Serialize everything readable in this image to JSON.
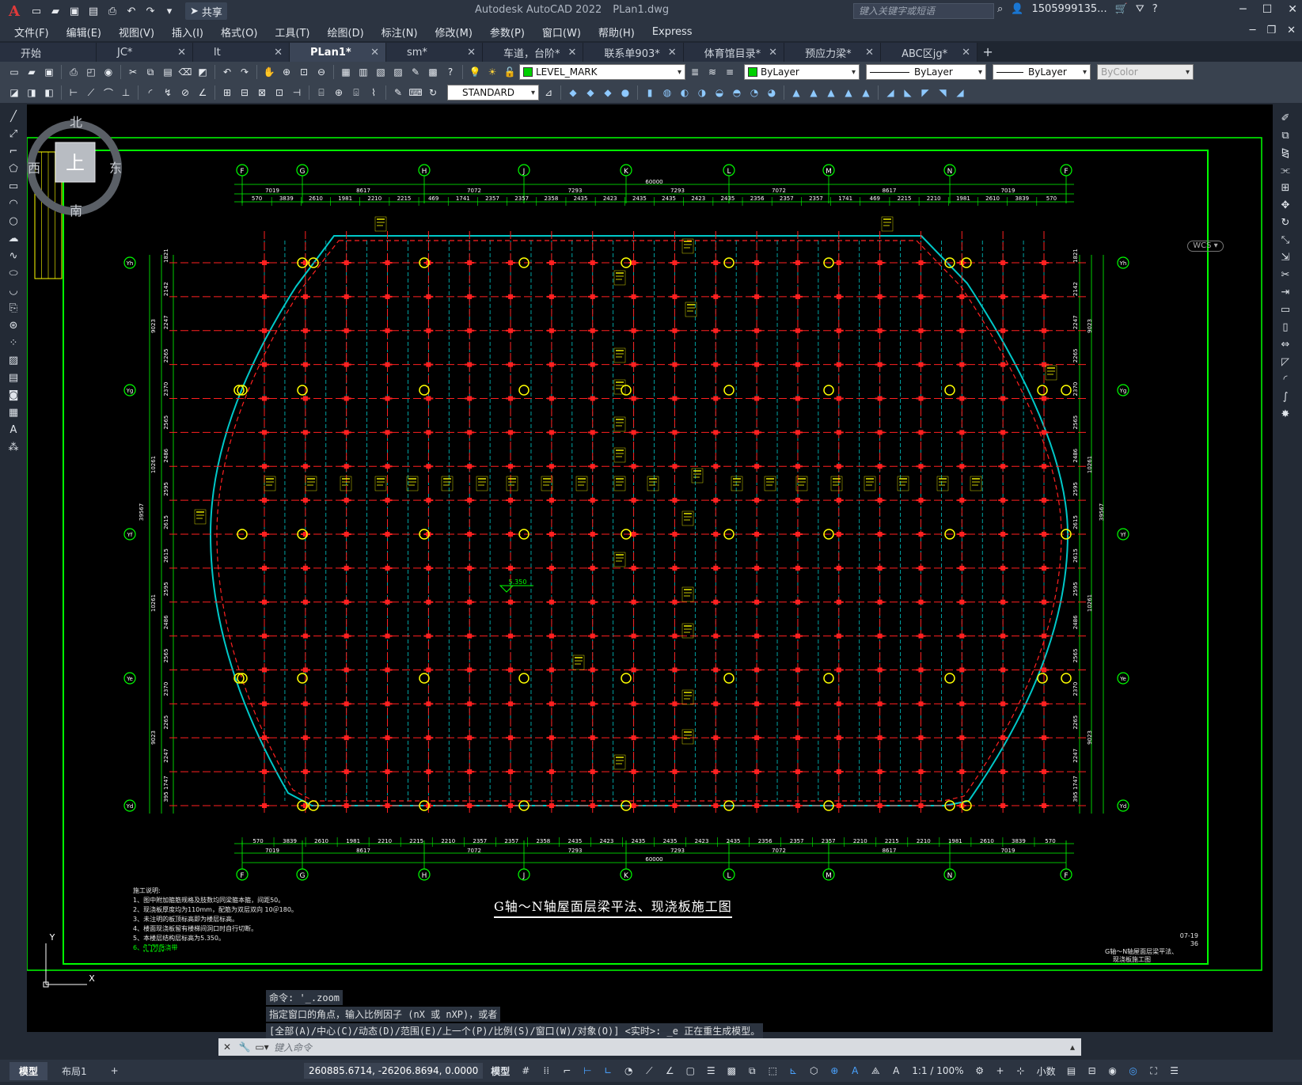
{
  "app": {
    "name": "Autodesk AutoCAD 2022",
    "file": "PLan1.dwg",
    "share_label": "共享",
    "search_placeholder": "键入关键字或短语",
    "user": "1505999135...",
    "logo": "A"
  },
  "menu": [
    "文件(F)",
    "编辑(E)",
    "视图(V)",
    "插入(I)",
    "格式(O)",
    "工具(T)",
    "绘图(D)",
    "标注(N)",
    "修改(M)",
    "参数(P)",
    "窗口(W)",
    "帮助(H)",
    "Express"
  ],
  "tabs": [
    {
      "label": "开始",
      "active": false
    },
    {
      "label": "JC*",
      "active": false
    },
    {
      "label": "lt",
      "active": false
    },
    {
      "label": "PLan1*",
      "active": true
    },
    {
      "label": "sm*",
      "active": false
    },
    {
      "label": "车道，台阶*",
      "active": false
    },
    {
      "label": "联系单903*",
      "active": false
    },
    {
      "label": "体育馆目录*",
      "active": false
    },
    {
      "label": "预应力梁*",
      "active": false
    },
    {
      "label": "ABC区jg*",
      "active": false
    }
  ],
  "properties": {
    "layer": "LEVEL_MARK",
    "color": "ByLayer",
    "linetype": "ByLayer",
    "lineweight": "ByLayer",
    "plotstyle": "ByColor",
    "textstyle": "STANDARD"
  },
  "viewcube": {
    "north": "北",
    "south": "南",
    "east": "东",
    "west": "西",
    "top": "上",
    "wcs": "WCS"
  },
  "drawing": {
    "title": "G轴～N轴屋面层梁平法、现浇板施工图",
    "level_mark": "5.350",
    "total_dim": "60000",
    "top_axes": [
      "F",
      "G",
      "H",
      "J",
      "K",
      "L",
      "M",
      "N",
      "F"
    ],
    "side_axes": [
      "Yh",
      "Yg",
      "Yf",
      "Ye",
      "Yd"
    ],
    "span_dims": [
      "7019",
      "8617",
      "7072",
      "7293",
      "7293",
      "7072",
      "8617",
      "7019"
    ],
    "detail_dims": [
      "570",
      "3839",
      "2610",
      "1981",
      "2210",
      "2215",
      "469",
      "1741",
      "2357",
      "2357",
      "2358",
      "2435",
      "2423",
      "2435",
      "2435",
      "2423",
      "2435",
      "2356",
      "2357",
      "2357",
      "1741",
      "469",
      "2215",
      "2210",
      "1981",
      "2610",
      "3839",
      "570"
    ],
    "bottom_detail_dims": [
      "570",
      "3839",
      "2610",
      "1981",
      "2210",
      "2215",
      "2210",
      "2357",
      "2357",
      "2358",
      "2435",
      "2423",
      "2435",
      "2435",
      "2423",
      "2435",
      "2356",
      "2357",
      "2357",
      "2210",
      "2215",
      "2210",
      "1981",
      "2610",
      "3839",
      "570"
    ],
    "left_dims": [
      "1821",
      "2142",
      "2247",
      "2265",
      "2370",
      "2565",
      "2486",
      "2595",
      "2615",
      "2615",
      "2595",
      "2486",
      "2565",
      "2370",
      "2265",
      "2247",
      "395 1747"
    ],
    "left_group_dims": [
      "9023",
      "10261",
      "39567",
      "10261",
      "9023"
    ],
    "notes_title": "施工说明:",
    "notes": [
      "1、图中附加箍筋规格及肢数均同梁箍本箍，间距50。",
      "2、现浇板厚度均为110mm，配筋为双层双向  10＠180。",
      "3、未注明的板顶标高即为楼层标高。",
      "4、楼面现浇板留有楼梯间洞口时自行切断。",
      "5、本楼层结构层标高为5.350。",
      "6、 [ ]为后浇带"
    ],
    "titleblock": [
      "07-19",
      "36",
      "G轴～N轴屋面层梁平法、",
      "现浇板施工图"
    ]
  },
  "command": {
    "history": [
      "命令: '_.zoom",
      "指定窗口的角点，输入比例因子 (nX 或 nXP)，或者",
      "[全部(A)/中心(C)/动态(D)/范围(E)/上一个(P)/比例(S)/窗口(W)/对象(O)] <实时>: _e 正在重生成模型。"
    ],
    "placeholder": "键入命令"
  },
  "layout_tabs": [
    {
      "label": "模型",
      "active": true
    },
    {
      "label": "布局1",
      "active": false
    }
  ],
  "status": {
    "coords": "260885.6714, -26206.8694, 0.0000",
    "space": "模型",
    "scale": "1:1 / 100%",
    "units": "小数"
  },
  "colors": {
    "bg": "#000000",
    "border": "#00ff00",
    "beam": "#ff2020",
    "grid": "#00c8c8",
    "axis": "#00ff00",
    "column": "#ffff00",
    "text": "#ffffff"
  }
}
